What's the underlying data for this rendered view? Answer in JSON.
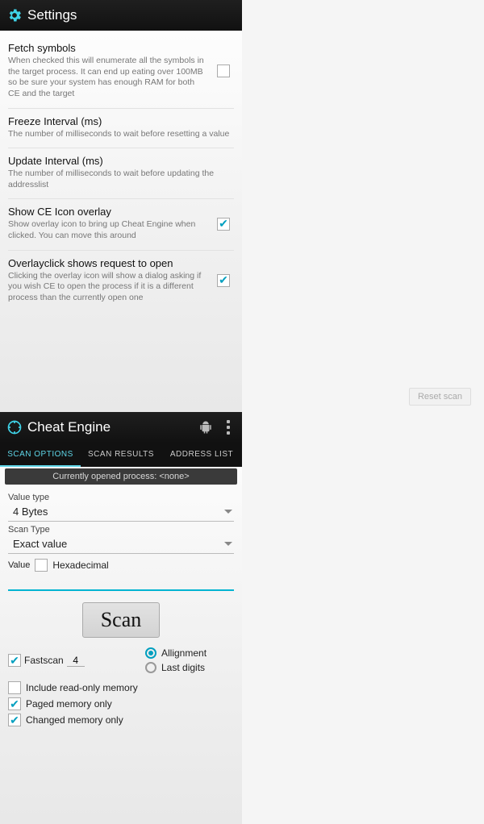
{
  "left": {
    "title": "Settings",
    "items": [
      {
        "title": "Fetch symbols",
        "desc": "When checked this will enumerate all the symbols in the target process. It can end up eating over 100MB so be sure your system has enough RAM for both CE and the target",
        "checked": false
      },
      {
        "title": "Freeze Interval (ms)",
        "desc": "The number of milliseconds to wait before resetting a value",
        "checked": null
      },
      {
        "title": "Update Interval (ms)",
        "desc": "The number of milliseconds to wait before updating the addresslist",
        "checked": null
      },
      {
        "title": "Show CE Icon overlay",
        "desc": "Show overlay icon to bring up Cheat Engine when clicked. You can move this around",
        "checked": true
      },
      {
        "title": "Overlayclick shows request to open",
        "desc": "Clicking the overlay icon will show a dialog asking if you wish CE to open the process if it is a different process than the currently open one",
        "checked": true
      }
    ]
  },
  "right": {
    "title": "Cheat Engine",
    "tabs": [
      "SCAN OPTIONS",
      "SCAN RESULTS",
      "ADDRESS LIST"
    ],
    "active_tab": 0,
    "process_label": "Currently opened process: <none>",
    "value_type_label": "Value type",
    "value_type": "4 Bytes",
    "scan_type_label": "Scan Type",
    "scan_type": "Exact value",
    "value_label": "Value",
    "hex_label": "Hexadecimal",
    "hex_checked": false,
    "value_input": "",
    "scan_button": "Scan",
    "fastscan_label": "Fastscan",
    "fastscan_checked": true,
    "fastscan_value": "4",
    "alignment_label": "Allignment",
    "lastdigits_label": "Last digits",
    "alignment_selected": true,
    "include_ro_label": "Include read-only memory",
    "include_ro_checked": false,
    "paged_label": "Paged memory only",
    "paged_checked": true,
    "changed_label": "Changed memory only",
    "changed_checked": true,
    "reset_button": "Reset scan"
  }
}
